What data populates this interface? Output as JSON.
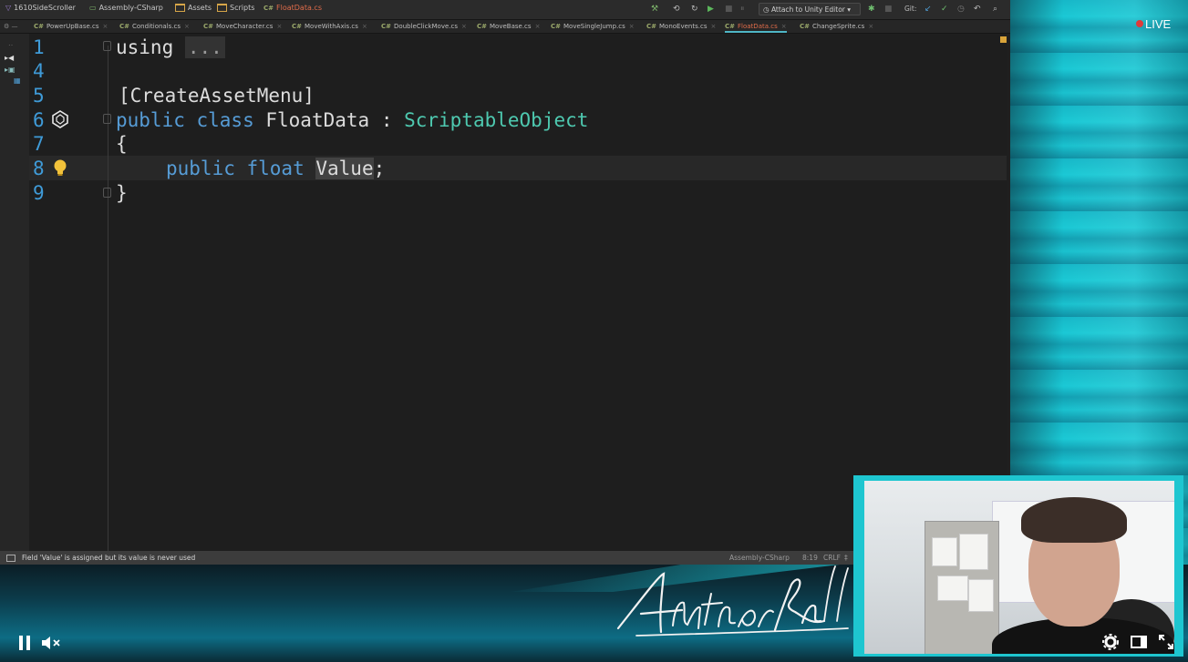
{
  "navbar": {
    "breadcrumbs": [
      {
        "label": "1610SideScroller"
      },
      {
        "label": "Assembly-CSharp"
      },
      {
        "label": "Assets"
      },
      {
        "label": "Scripts"
      },
      {
        "label": "FloatData.cs",
        "lang": "C#"
      }
    ],
    "attach_label": "Attach to Unity Editor",
    "git_label": "Git:"
  },
  "tabs": [
    {
      "label": "PowerUpBase.cs"
    },
    {
      "label": "Conditionals.cs"
    },
    {
      "label": "MoveCharacter.cs"
    },
    {
      "label": "MoveWithAxis.cs"
    },
    {
      "label": "DoubleClickMove.cs"
    },
    {
      "label": "MoveBase.cs"
    },
    {
      "label": "MoveSingleJump.cs"
    },
    {
      "label": "MonoEvents.cs"
    },
    {
      "label": "FloatData.cs",
      "active": true
    },
    {
      "label": "ChangeSprite.cs"
    }
  ],
  "tab_lang": "C#",
  "editor": {
    "line_numbers": [
      "1",
      "4",
      "5",
      "6",
      "7",
      "8",
      "9"
    ],
    "code": {
      "l1_kw": "using",
      "l1_fold": "...",
      "l5": "[CreateAssetMenu]",
      "l6_kw": "public class",
      "l6_name": "FloatData",
      "l6_colon": " : ",
      "l6_type": "ScriptableObject",
      "l7": "{",
      "l8_kw": "public float",
      "l8_name": "Value",
      "l8_end": ";",
      "l9": "}"
    }
  },
  "statusbar": {
    "message": "Field 'Value' is assigned but its value is never used",
    "project": "Assembly-CSharp",
    "position": "8:19",
    "line_ending": "CRLF",
    "indent": "‡"
  },
  "player": {
    "live_label": "LIVE"
  },
  "overlay": {
    "signature_text": "Anthony Romrell"
  }
}
